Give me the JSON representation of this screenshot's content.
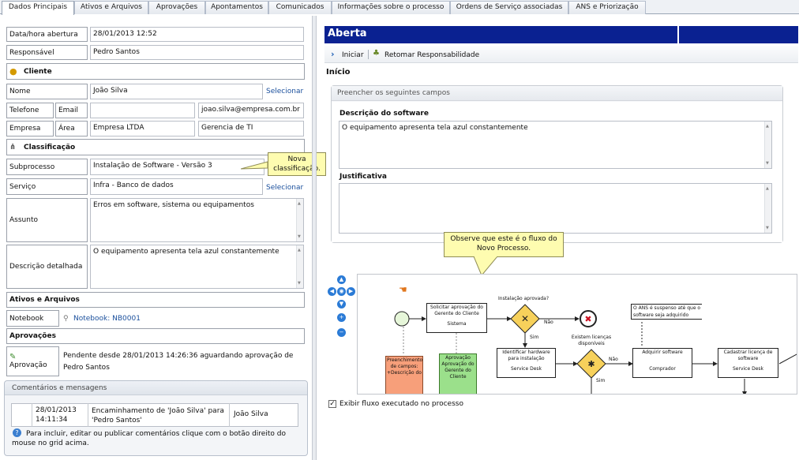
{
  "tabs": [
    "Dados Principais",
    "Ativos e Arquivos",
    "Aprovações",
    "Apontamentos",
    "Comunicados",
    "Informações sobre o processo",
    "Ordens de Serviço associadas",
    "ANS e Priorização"
  ],
  "form": {
    "data_hora_label": "Data/hora abertura",
    "data_hora_value": "28/01/2013 12:52",
    "responsavel_label": "Responsável",
    "responsavel_value": "Pedro Santos",
    "cliente_title": "Cliente",
    "nome_label": "Nome",
    "nome_value": "João Silva",
    "selecionar": "Selecionar",
    "telefone_label": "Telefone",
    "email_label": "Email",
    "email_value": "joao.silva@empresa.com.br",
    "empresa_label": "Empresa",
    "empresa_value": "Empresa LTDA",
    "area_label": "Área",
    "area_value": "Gerencia de TI",
    "classificacao_title": "Classificação",
    "subprocesso_label": "Subprocesso",
    "subprocesso_value": "Instalação de Software - Versão 3",
    "servico_label": "Serviço",
    "servico_value": "Infra - Banco de dados",
    "assunto_label": "Assunto",
    "assunto_value": "Erros em software, sistema ou equipamentos",
    "descricao_label": "Descrição detalhada",
    "descricao_value": "O equipamento apresenta tela azul constantemente",
    "ativos_title": "Ativos e Arquivos",
    "notebook_label": "Notebook",
    "notebook_link": "Notebook: NB0001",
    "aprovacoes_title": "Aprovações",
    "aprovacao_label": "Aprovação",
    "aprovacao_text": "Pendente desde 28/01/2013 14:26:36 aguardando aprovação de Pedro Santos",
    "tooltip_classificacao": "Nova classificação."
  },
  "comentarios": {
    "title": "Comentários e mensagens",
    "date": "28/01/2013",
    "time": "14:11:34",
    "message": "Encaminhamento de 'João Silva' para 'Pedro Santos'",
    "author": "João Silva",
    "hint": "Para incluir, editar ou publicar comentários clique com o botão direito do mouse no grid acima."
  },
  "right": {
    "status": "Aberta",
    "iniciar": "Iniciar",
    "retomar": "Retomar Responsabilidade",
    "inicio": "Início",
    "preencher": "Preencher os seguintes campos",
    "descricao_software_label": "Descrição do software",
    "descricao_software_value": "O equipamento apresenta tela azul constantemente",
    "justificativa_label": "Justificativa",
    "tooltip_fluxo": "Observe que este é o fluxo do Novo Processo.",
    "exibir_fluxo": "Exibir fluxo executado no processo"
  },
  "diagram": {
    "solicitar": "Solicitar aprovação do Gerente do Cliente",
    "sistema": "Sistema",
    "instalacao_aprovada": "Instalação aprovada?",
    "nao": "Não",
    "sim": "Sim",
    "identificar": "Identificar hardware para instalação",
    "service_desk": "Service Desk",
    "existem_licencas": "Existem licenças disponíveis",
    "adquirir": "Adquirir software",
    "comprador": "Comprador",
    "cadastrar": "Cadastrar licença de software",
    "ans_note": "O ANS é suspenso até que o software seja adquirido",
    "doc_orange": "Preenchimento de campos: +Descrição do",
    "doc_green": "Aprovação Aprovação do Gerente do Cliente"
  },
  "colors": {
    "status_bar": "#0a2191",
    "tooltip_bg": "#fefcb0",
    "link": "#1a4f9c"
  }
}
